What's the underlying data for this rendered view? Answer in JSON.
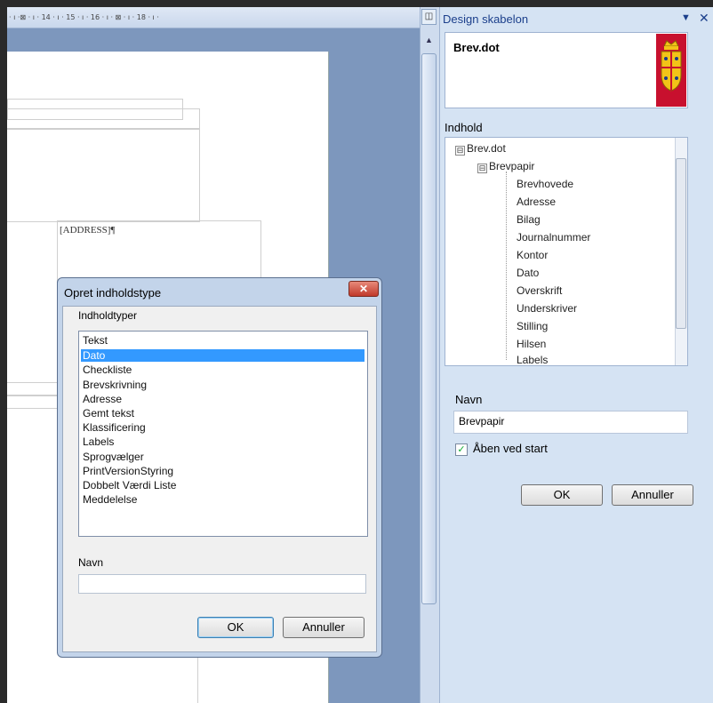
{
  "ruler": {
    "text": "· ı ·⊠ · ı · 14 · ı · 15 · ı · 16 · ı · ⊠ · ı · 18 · ı ·"
  },
  "document": {
    "address_field": "[ADDRESS]¶"
  },
  "task_pane": {
    "title": "Design skabelon",
    "template_name": "Brev.dot",
    "content_label": "Indhold",
    "tree": [
      {
        "label": "Brev.dot",
        "expander": "⊟"
      },
      {
        "label": "Brevpapir",
        "expander": "⊟"
      },
      {
        "label": "Brevhovede"
      },
      {
        "label": "Adresse"
      },
      {
        "label": "Bilag"
      },
      {
        "label": "Journalnummer"
      },
      {
        "label": "Kontor"
      },
      {
        "label": "Dato"
      },
      {
        "label": "Overskrift"
      },
      {
        "label": "Underskriver"
      },
      {
        "label": "Stilling"
      },
      {
        "label": "Hilsen"
      },
      {
        "label": "Labels"
      }
    ],
    "name_label": "Navn",
    "name_value": "Brevpapir",
    "open_at_start_label": "Åben ved start",
    "open_at_start_checked": true,
    "ok_label": "OK",
    "cancel_label": "Annuller"
  },
  "dialog": {
    "title": "Opret indholdstype",
    "close_glyph": "✕",
    "types_label": "Indholdtyper",
    "types": [
      "Tekst",
      "Dato",
      "Checkliste",
      "Brevskrivning",
      "Adresse",
      "Gemt tekst",
      "Klassificering",
      "Labels",
      "Sprogvælger",
      "PrintVersionStyring",
      "Dobbelt Værdi Liste",
      "Meddelelse"
    ],
    "selected_type": "Dato",
    "name_label": "Navn",
    "name_value": "",
    "ok_label": "OK",
    "cancel_label": "Annuller"
  },
  "colors": {
    "accent": "#1b3f8b",
    "selection": "#3399ff",
    "pane_bg": "#d5e3f3",
    "coat_of_arms": "#c8102e"
  },
  "icons": {
    "pane_dropdown": "▼",
    "pane_close": "✕",
    "scroll_up": "▲",
    "checkbox_check": "✓",
    "task_pane_icon": "◫"
  }
}
